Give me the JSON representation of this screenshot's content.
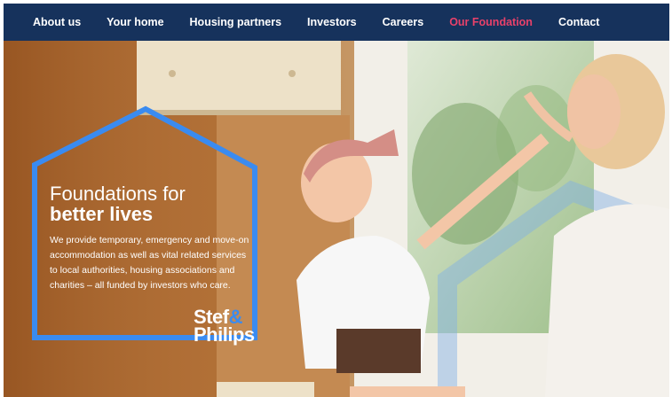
{
  "nav": {
    "items": [
      {
        "label": "About us",
        "active": false
      },
      {
        "label": "Your home",
        "active": false
      },
      {
        "label": "Housing partners",
        "active": false
      },
      {
        "label": "Investors",
        "active": false
      },
      {
        "label": "Careers",
        "active": false
      },
      {
        "label": "Our Foundation",
        "active": true
      },
      {
        "label": "Contact",
        "active": false
      }
    ],
    "background_color": "#16325c",
    "active_color": "#e8416a"
  },
  "hero": {
    "title_line1": "Foundations for",
    "title_line2": "better lives",
    "body": "We provide temporary, emergency and move-on accommodation as well as vital related services to local authorities, housing associations and charities – all funded by investors who care.",
    "house_outline_color": "#3a8bf0"
  },
  "logo": {
    "line1": "Stef",
    "ampersand": "&",
    "line2": "Philips"
  }
}
